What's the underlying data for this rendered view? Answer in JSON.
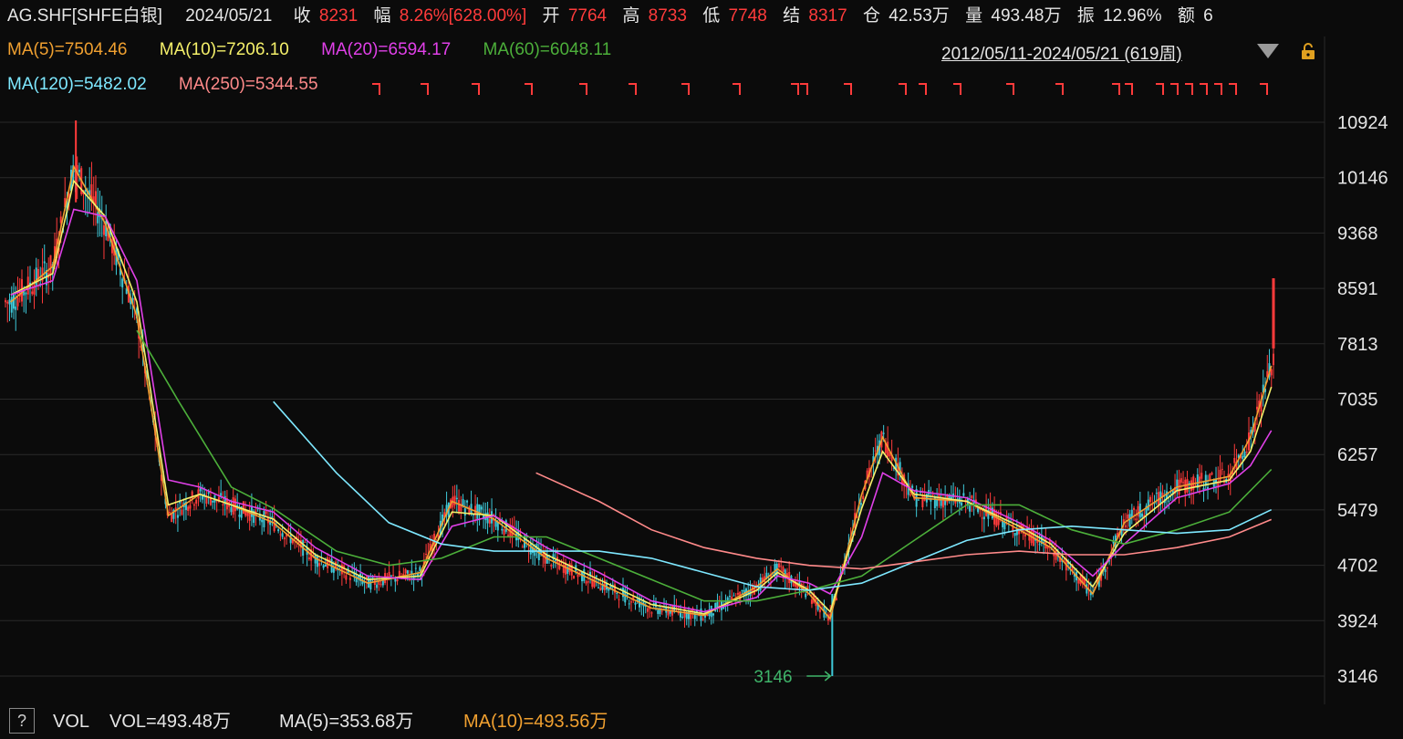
{
  "header": {
    "symbol": "AG.SHF[SHFE白银]",
    "date": "2024/05/21",
    "close_label": "收",
    "close": "8231",
    "change_label": "幅",
    "change": "8.26%[628.00%]",
    "open_label": "开",
    "open": "7764",
    "high_label": "高",
    "high": "8733",
    "low_label": "低",
    "low": "7748",
    "settle_label": "结",
    "settle": "8317",
    "oi_label": "仓",
    "oi": "42.53万",
    "vol_label": "量",
    "vol": "493.48万",
    "amp_label": "振",
    "amp": "12.96%",
    "amt_label": "额",
    "amt": "6"
  },
  "ma_legend": [
    {
      "text": "MA(5)=7504.46",
      "color": "#f0a030"
    },
    {
      "text": "MA(10)=7206.10",
      "color": "#f5f06a"
    },
    {
      "text": "MA(20)=6594.17",
      "color": "#e040e8"
    },
    {
      "text": "MA(60)=6048.11",
      "color": "#4caf3a"
    },
    {
      "text": "MA(120)=5482.02",
      "color": "#7ee8ff"
    },
    {
      "text": "MA(250)=5344.55",
      "color": "#ff8a8a"
    }
  ],
  "range_text": "2012/05/11-2024/05/21 (619周)",
  "footer": {
    "help": "?",
    "vol_name": "VOL",
    "vol_value": "VOL=493.48万",
    "ma5": "MA(5)=353.68万",
    "ma10": "MA(10)=493.56万"
  },
  "colors": {
    "up": "#ff3b3b",
    "down": "#3ec8d8",
    "axis_text": "#e6e6e6",
    "min_marker": "#3fb56a"
  },
  "chart_data": {
    "type": "line",
    "title": "",
    "xlabel": "",
    "ylabel": "",
    "x_range": [
      "2012/05/11",
      "2024/05/21"
    ],
    "yticks": [
      10924,
      10146,
      9368,
      8591,
      7813,
      7035,
      6257,
      5479,
      4702,
      3924,
      3146
    ],
    "ylim": [
      2950,
      11500
    ],
    "min_annotation": {
      "label": "3146",
      "value": 3146,
      "date": "2020/03"
    },
    "series": [
      {
        "name": "MA(5)",
        "color": "#f0a030",
        "x": [
          2012.4,
          2012.8,
          2013.0,
          2013.3,
          2013.6,
          2013.9,
          2014.2,
          2014.5,
          2014.9,
          2015.3,
          2015.8,
          2016.3,
          2016.6,
          2017.0,
          2017.5,
          2018.0,
          2018.5,
          2019.0,
          2019.5,
          2019.7,
          2020.0,
          2020.2,
          2020.5,
          2020.7,
          2021.0,
          2021.5,
          2022.0,
          2022.3,
          2022.7,
          2023.0,
          2023.5,
          2024.0,
          2024.2,
          2024.4
        ],
        "values": [
          8400,
          8900,
          10300,
          9500,
          8200,
          5400,
          5700,
          5550,
          5300,
          4800,
          4450,
          4600,
          5600,
          5350,
          4800,
          4450,
          4100,
          4000,
          4400,
          4650,
          4300,
          3950,
          5700,
          6500,
          5650,
          5600,
          5200,
          4950,
          4300,
          5300,
          5800,
          5950,
          6500,
          7504.46
        ]
      },
      {
        "name": "MA(10)",
        "color": "#f5f06a",
        "x": [
          2012.4,
          2012.8,
          2013.0,
          2013.3,
          2013.6,
          2013.9,
          2014.2,
          2014.5,
          2014.9,
          2015.3,
          2015.8,
          2016.3,
          2016.6,
          2017.0,
          2017.5,
          2018.0,
          2018.5,
          2019.0,
          2019.5,
          2019.7,
          2020.0,
          2020.2,
          2020.5,
          2020.7,
          2021.0,
          2021.5,
          2022.0,
          2022.3,
          2022.7,
          2023.0,
          2023.5,
          2024.0,
          2024.2,
          2024.4
        ],
        "values": [
          8500,
          8800,
          10100,
          9600,
          8400,
          5550,
          5700,
          5550,
          5350,
          4850,
          4500,
          4550,
          5450,
          5400,
          4850,
          4500,
          4150,
          4020,
          4350,
          4600,
          4350,
          4050,
          5500,
          6300,
          5700,
          5600,
          5250,
          5000,
          4400,
          5150,
          5750,
          5900,
          6300,
          7206.1
        ]
      },
      {
        "name": "MA(20)",
        "color": "#e040e8",
        "x": [
          2012.4,
          2012.8,
          2013.0,
          2013.3,
          2013.6,
          2013.9,
          2014.2,
          2014.5,
          2014.9,
          2015.3,
          2015.8,
          2016.3,
          2016.6,
          2017.0,
          2017.5,
          2018.0,
          2018.5,
          2019.0,
          2019.5,
          2019.7,
          2020.0,
          2020.2,
          2020.5,
          2020.7,
          2021.0,
          2021.5,
          2022.0,
          2022.3,
          2022.7,
          2023.0,
          2023.5,
          2024.0,
          2024.2,
          2024.4
        ],
        "values": [
          8500,
          8700,
          9700,
          9600,
          8700,
          5900,
          5800,
          5600,
          5450,
          4950,
          4550,
          4500,
          5250,
          5400,
          4950,
          4600,
          4200,
          4050,
          4250,
          4550,
          4450,
          4300,
          5100,
          6000,
          5750,
          5650,
          5300,
          5050,
          4550,
          5000,
          5650,
          5850,
          6100,
          6594.17
        ]
      },
      {
        "name": "MA(60)",
        "color": "#4caf3a",
        "x": [
          2013.6,
          2014.0,
          2014.5,
          2014.9,
          2015.5,
          2016.0,
          2016.5,
          2017.0,
          2017.5,
          2018.0,
          2018.5,
          2019.0,
          2019.5,
          2020.0,
          2020.5,
          2021.0,
          2021.5,
          2022.0,
          2022.5,
          2023.0,
          2023.5,
          2024.0,
          2024.4
        ],
        "values": [
          8000,
          7000,
          5800,
          5500,
          4900,
          4700,
          4800,
          5100,
          5100,
          4800,
          4500,
          4200,
          4200,
          4350,
          4550,
          5050,
          5550,
          5550,
          5200,
          5000,
          5200,
          5450,
          6048.11
        ]
      },
      {
        "name": "MA(120)",
        "color": "#7ee8ff",
        "x": [
          2014.9,
          2015.5,
          2016.0,
          2016.5,
          2017.0,
          2017.5,
          2018.0,
          2018.5,
          2019.0,
          2019.5,
          2020.0,
          2020.5,
          2021.0,
          2021.5,
          2022.0,
          2022.5,
          2023.0,
          2023.5,
          2024.0,
          2024.4
        ],
        "values": [
          7000,
          6000,
          5300,
          5000,
          4900,
          4900,
          4900,
          4800,
          4600,
          4400,
          4350,
          4450,
          4750,
          5050,
          5200,
          5250,
          5200,
          5150,
          5200,
          5482.02
        ]
      },
      {
        "name": "MA(250)",
        "color": "#ff8a8a",
        "x": [
          2017.4,
          2018.0,
          2018.5,
          2019.0,
          2019.5,
          2020.0,
          2020.5,
          2021.0,
          2021.5,
          2022.0,
          2022.5,
          2023.0,
          2023.5,
          2024.0,
          2024.4
        ],
        "values": [
          6000,
          5600,
          5200,
          4950,
          4800,
          4700,
          4650,
          4750,
          4850,
          4900,
          4850,
          4850,
          4950,
          5100,
          5344.55
        ]
      }
    ]
  }
}
